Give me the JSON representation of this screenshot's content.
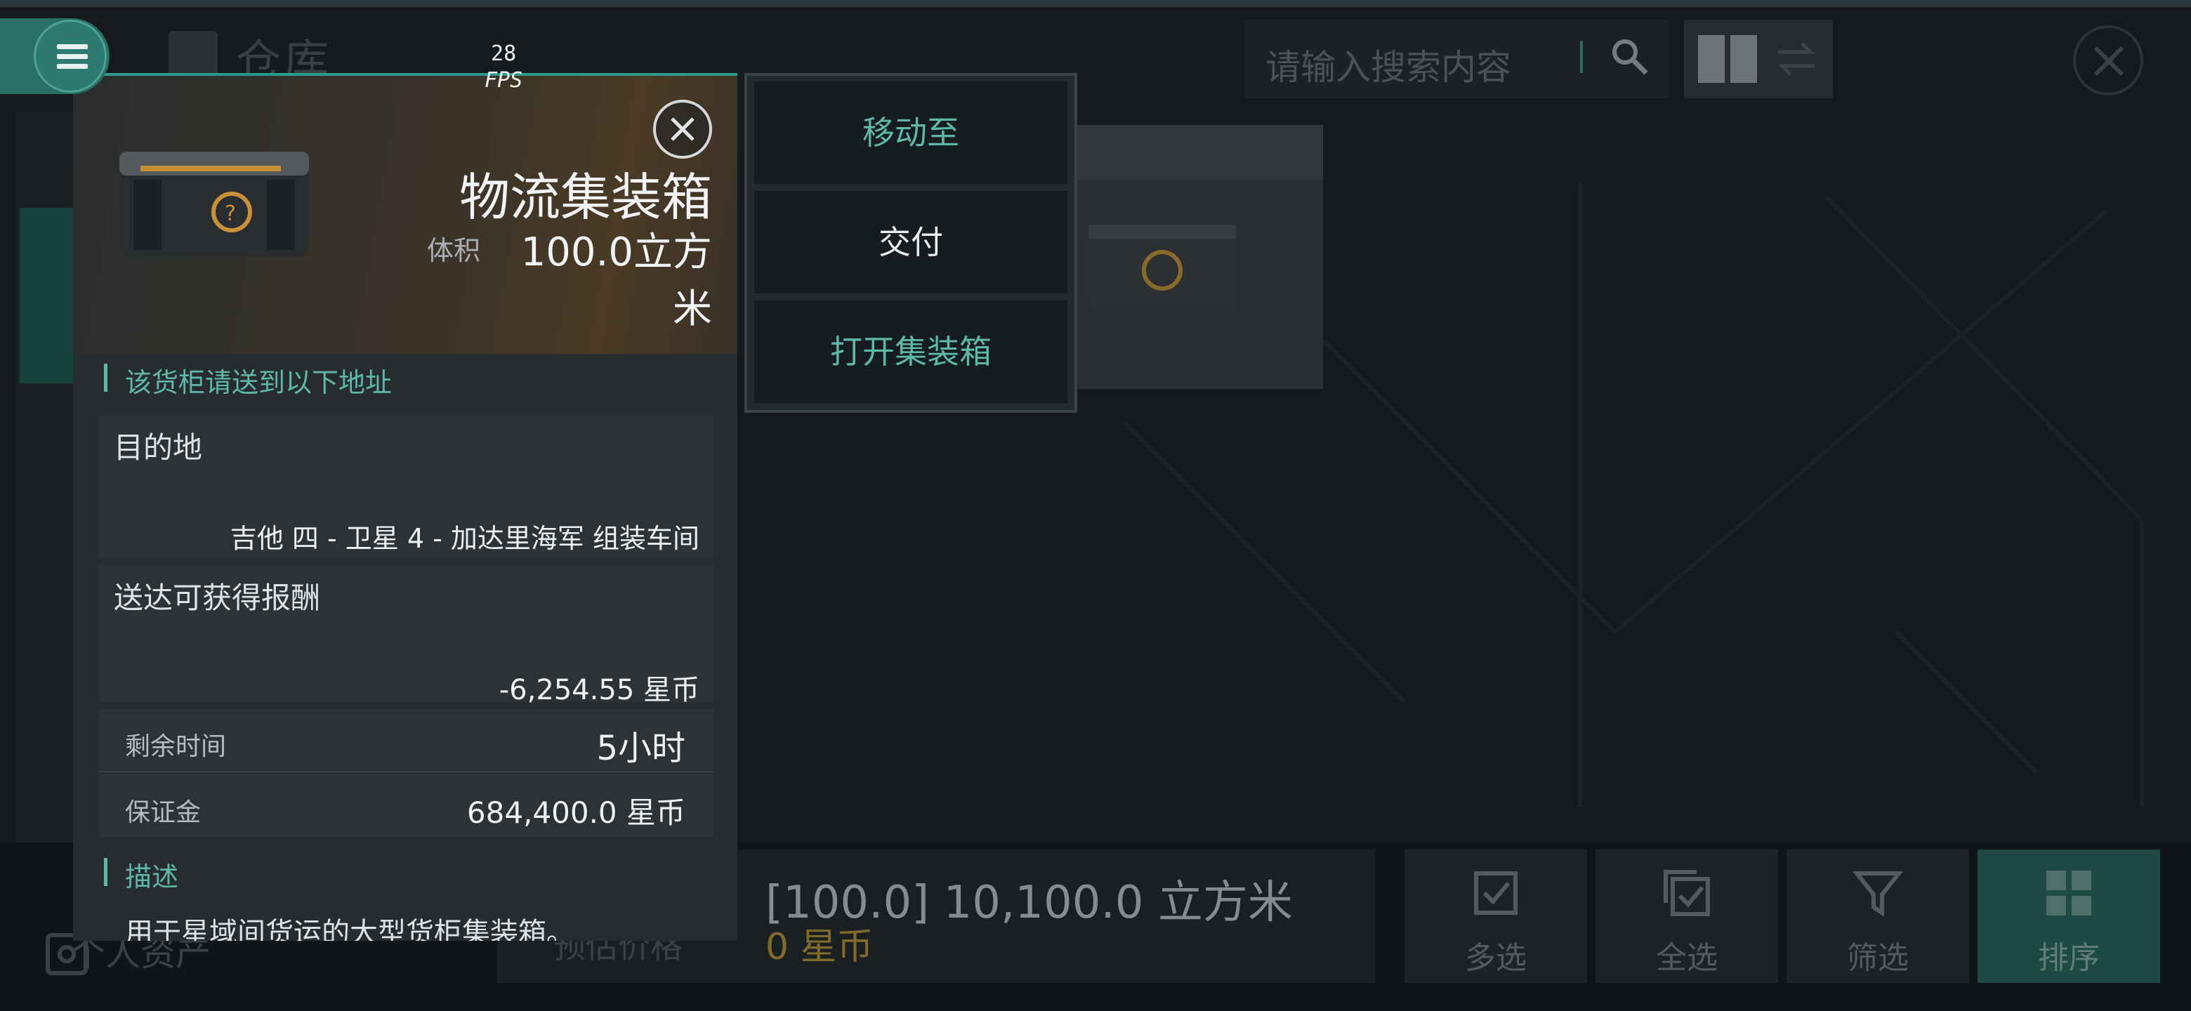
{
  "fps": {
    "value": "28",
    "unit": "FPS"
  },
  "background": {
    "title": "仓库",
    "search_placeholder": "请输入搜索内容",
    "personal_assets": "个人资产",
    "estimate_label": "预估价格",
    "volume_total": "[100.0] 10,100.0 立方米",
    "coin_total": "0 星币",
    "toolbar": [
      {
        "label": "多选",
        "icon": "checkbox-icon"
      },
      {
        "label": "全选",
        "icon": "select-all-icon"
      },
      {
        "label": "筛选",
        "icon": "filter-icon"
      },
      {
        "label": "排序",
        "icon": "sort-grid-icon"
      }
    ]
  },
  "detail": {
    "name": "物流集装箱",
    "volume_label": "体积",
    "volume_value": "100.0立方米",
    "address_section": "该货柜请送到以下地址",
    "destination_label": "目的地",
    "destination_value": "吉他 四 - 卫星 4 - 加达里海军 组装车间",
    "reward_label": "送达可获得报酬",
    "reward_value": "-6,254.55 星币",
    "time_label": "剩余时间",
    "time_value": "5小时",
    "deposit_label": "保证金",
    "deposit_value": "684,400.0 星币",
    "desc_section": "描述",
    "desc_text": "用于星域间货运的大型货柜集装箱。"
  },
  "context_menu": {
    "move_to": "移动至",
    "deliver": "交付",
    "open_container": "打开集装箱"
  },
  "colors": {
    "accent": "#5fb7a9",
    "gold": "#806a2c"
  }
}
